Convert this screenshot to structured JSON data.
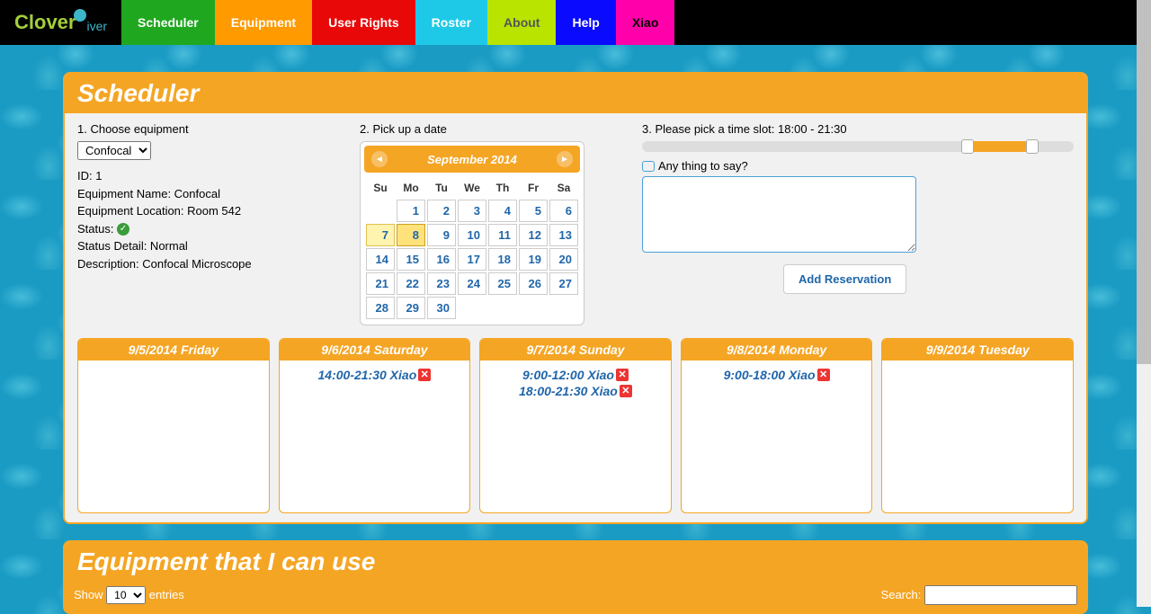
{
  "nav": {
    "logo": {
      "part1": "Clover",
      "part2": "iver"
    },
    "items": [
      {
        "label": "Scheduler",
        "bg": "#1fa81f"
      },
      {
        "label": "Equipment",
        "bg": "#ff9a00"
      },
      {
        "label": "User Rights",
        "bg": "#e90808"
      },
      {
        "label": "Roster",
        "bg": "#1ec9e8"
      },
      {
        "label": "About",
        "bg": "#b8e400",
        "color": "#555"
      },
      {
        "label": "Help",
        "bg": "#0a0aff"
      },
      {
        "label": "Xiao",
        "bg": "#ff00aa",
        "color": "#000"
      }
    ]
  },
  "scheduler": {
    "title": "Scheduler",
    "step1": {
      "label": "1. Choose equipment",
      "select_value": "Confocal",
      "id_label": "ID: 1",
      "name_label": "Equipment Name: Confocal",
      "loc_label": "Equipment Location: Room 542",
      "status_label": "Status:",
      "status_detail": "Status Detail: Normal",
      "desc": "Description: Confocal Microscope"
    },
    "step2": {
      "label": "2. Pick up a date",
      "month": "September 2014",
      "dow": [
        "Su",
        "Mo",
        "Tu",
        "We",
        "Th",
        "Fr",
        "Sa"
      ],
      "weeks": [
        [
          "",
          "1",
          "2",
          "3",
          "4",
          "5",
          "6"
        ],
        [
          "7",
          "8",
          "9",
          "10",
          "11",
          "12",
          "13"
        ],
        [
          "14",
          "15",
          "16",
          "17",
          "18",
          "19",
          "20"
        ],
        [
          "21",
          "22",
          "23",
          "24",
          "25",
          "26",
          "27"
        ],
        [
          "28",
          "29",
          "30",
          "",
          "",
          "",
          ""
        ]
      ],
      "today": "7",
      "selected": "8"
    },
    "step3": {
      "label": "3. Please pick a time slot: 18:00 - 21:30",
      "comment_label": "Any thing to say?",
      "button": "Add Reservation"
    },
    "days": [
      {
        "head": "9/5/2014 Friday",
        "res": []
      },
      {
        "head": "9/6/2014 Saturday",
        "res": [
          "14:00-21:30 Xiao"
        ]
      },
      {
        "head": "9/7/2014 Sunday",
        "res": [
          "9:00-12:00 Xiao",
          "18:00-21:30 Xiao"
        ]
      },
      {
        "head": "9/8/2014 Monday",
        "res": [
          "9:00-18:00 Xiao"
        ]
      },
      {
        "head": "9/9/2014 Tuesday",
        "res": []
      }
    ]
  },
  "equipment_panel": {
    "title": "Equipment that I can use",
    "show_label": "Show",
    "show_value": "10",
    "entries_label": "entries",
    "search_label": "Search:"
  }
}
